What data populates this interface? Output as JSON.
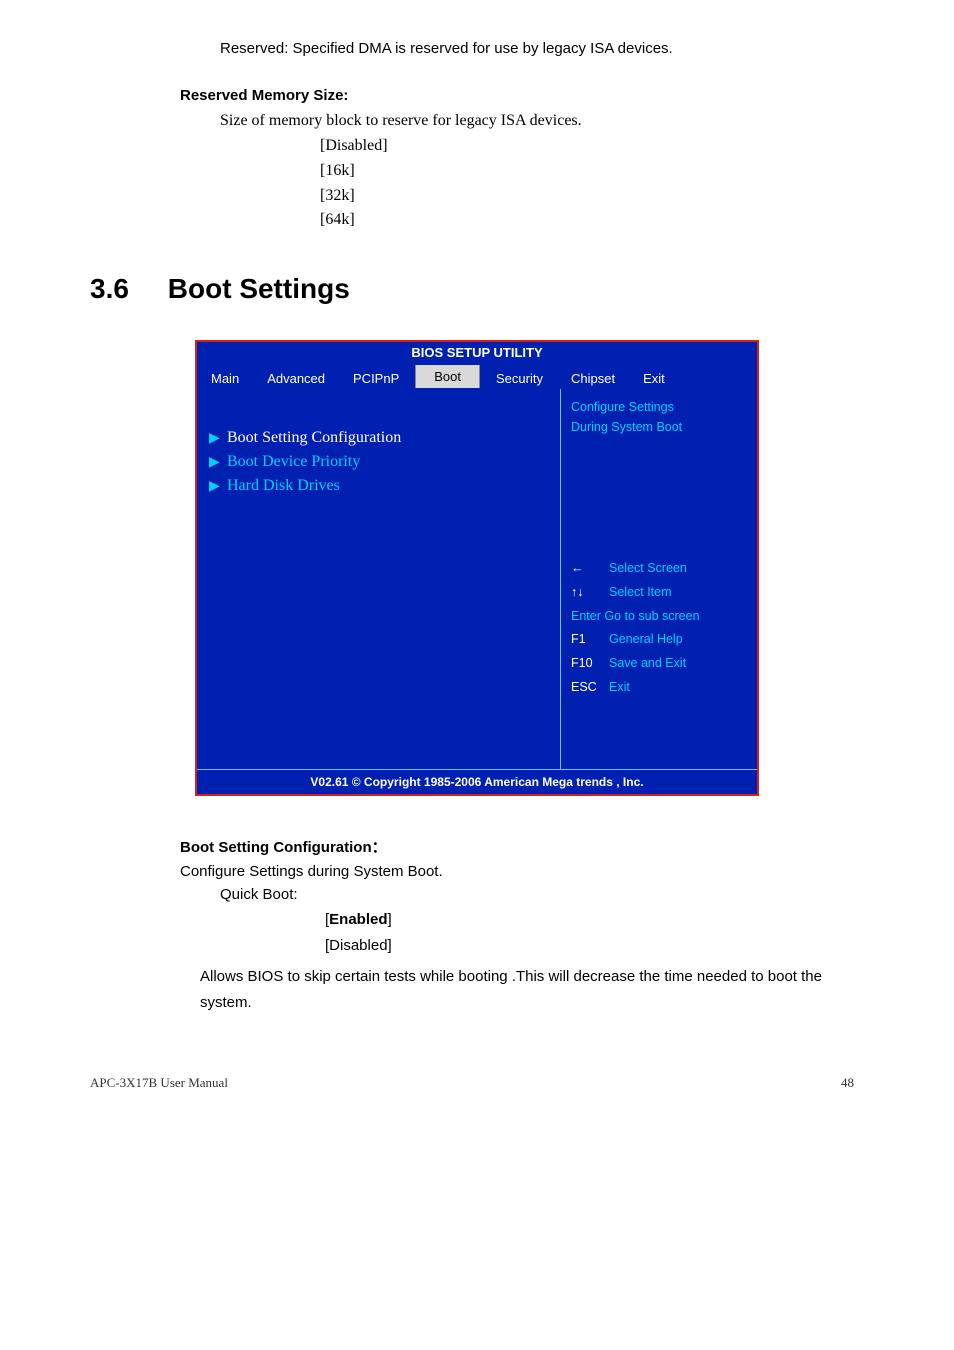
{
  "top_text": "Reserved: Specified DMA is reserved for use by legacy ISA devices.",
  "reserved_mem_heading": "Reserved Memory Size:",
  "reserved_mem_desc": "Size of memory block to reserve for legacy ISA devices.",
  "mem_opts": [
    "[Disabled]",
    "[16k]",
    "[32k]",
    "[64k]"
  ],
  "section_num": "3.6",
  "section_title": "Boot Settings",
  "bios": {
    "title": "BIOS SETUP UTILITY",
    "tabs": {
      "main": "Main",
      "advanced": "Advanced",
      "pcipnp": "PCIPnP",
      "boot": "Boot",
      "security": "Security",
      "chipset": "Chipset",
      "exit": "Exit"
    },
    "menu": {
      "boot_setting_config": "Boot Setting Configuration",
      "boot_device_priority": "Boot Device Priority",
      "hard_disk_drives": "Hard Disk Drives"
    },
    "side": {
      "line1": "Configure Settings",
      "line2": "During System Boot",
      "k1": {
        "key": "←",
        "desc": "Select Screen"
      },
      "k2": {
        "key": "↑↓",
        "desc": "Select Item"
      },
      "k3": {
        "key": "Enter",
        "k3full": "Enter Go to sub screen"
      },
      "k4": {
        "key": "F1",
        "desc": "General Help"
      },
      "k5": {
        "key": "F10",
        "desc": "Save and Exit"
      },
      "k6": {
        "key": "ESC",
        "desc": "Exit"
      }
    },
    "footer": "V02.61 © Copyright 1985-2006 American Mega trends , Inc."
  },
  "sub": {
    "heading": "Boot Setting Configuration：",
    "line1": "Configure Settings during System Boot.",
    "quick_boot": "Quick Boot:",
    "opt_enabled_pre": "[",
    "opt_enabled_bold": "Enabled",
    "opt_enabled_post": "]",
    "opt_disabled": "[Disabled]",
    "desc": "Allows BIOS to skip certain tests while booting .This will decrease the time needed to boot the system."
  },
  "footer_left": "APC-3X17B User Manual",
  "footer_right": "48"
}
